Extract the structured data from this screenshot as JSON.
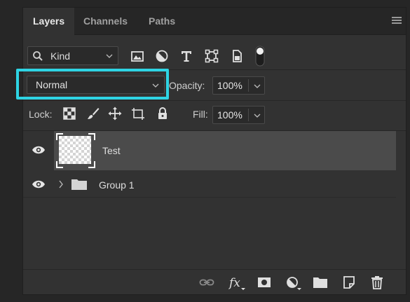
{
  "tabs": [
    {
      "label": "Layers",
      "active": true
    },
    {
      "label": "Channels",
      "active": false
    },
    {
      "label": "Paths",
      "active": false
    }
  ],
  "filter": {
    "kind_label": "Kind",
    "icons": [
      "image-filter-icon",
      "adjustment-filter-icon",
      "type-filter-icon",
      "shape-filter-icon",
      "smart-object-filter-icon",
      "filter-toggle-icon"
    ]
  },
  "blend": {
    "mode": "Normal",
    "opacity_label": "Opacity:",
    "opacity_value": "100%"
  },
  "lock": {
    "label": "Lock:",
    "fill_label": "Fill:",
    "fill_value": "100%"
  },
  "layers": [
    {
      "name": "Test",
      "visible": true,
      "selected": true,
      "type": "pixel"
    },
    {
      "name": "Group 1",
      "visible": true,
      "selected": false,
      "type": "group"
    }
  ],
  "bottom_icons": [
    "link-layers-icon",
    "fx-icon",
    "add-mask-icon",
    "adjustment-layer-icon",
    "new-group-icon",
    "new-layer-icon",
    "delete-layer-icon"
  ],
  "colors": {
    "highlight": "#2ed4e4",
    "panel": "#323232",
    "selected_row": "#4b4b4b"
  }
}
